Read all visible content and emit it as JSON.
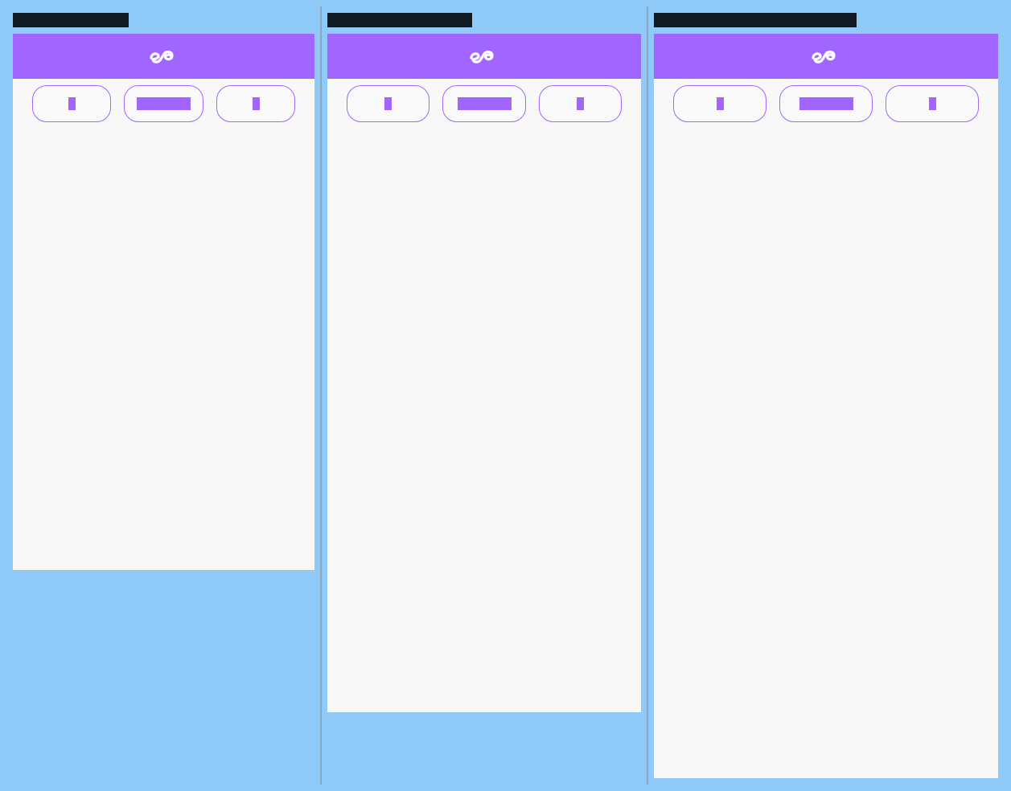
{
  "colors": {
    "page_background": "#90caf9",
    "title_redaction": "#111a23",
    "header_purple": "#a066ff",
    "panel_background": "#f8f8f8",
    "divider": "#8aa7c2"
  },
  "header_logo_icon": "ea-infinity-logo-icon",
  "columns": [
    {
      "title": "",
      "buttons": [
        "",
        "",
        ""
      ]
    },
    {
      "title": "",
      "buttons": [
        "",
        "",
        ""
      ]
    },
    {
      "title": "",
      "buttons": [
        "",
        "",
        ""
      ]
    }
  ]
}
